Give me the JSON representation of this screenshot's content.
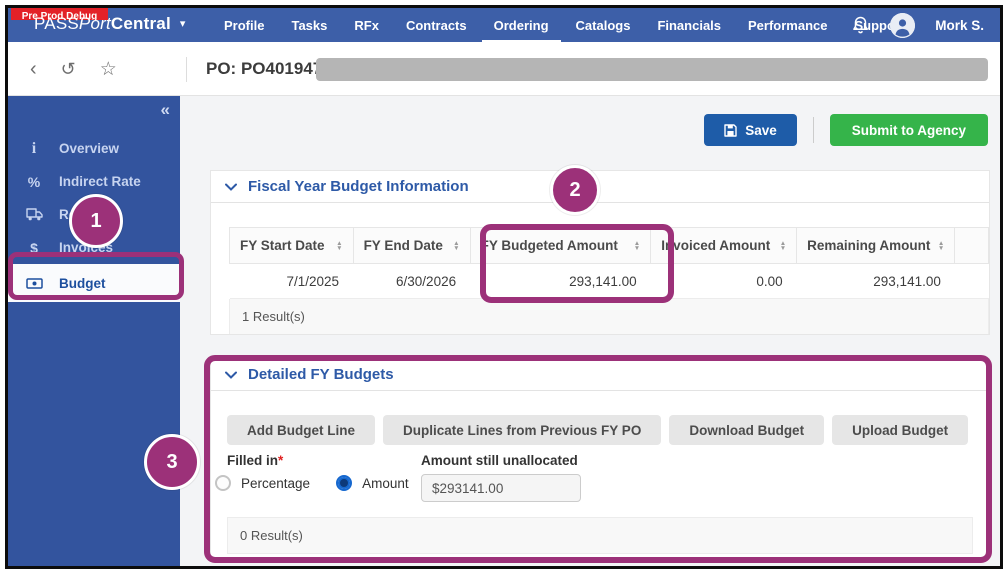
{
  "env_badge": "Pre Prod Debug",
  "brand": {
    "part1": "PASS",
    "part2": "Port",
    "part3": "Central"
  },
  "nav": {
    "items": [
      "Profile",
      "Tasks",
      "RFx",
      "Contracts",
      "Ordering",
      "Catalogs",
      "Financials",
      "Performance",
      "Support"
    ],
    "active_item": "Ordering",
    "user_name": "Mork S."
  },
  "po_header": {
    "title": "PO: PO401947"
  },
  "sidebar": {
    "items": [
      {
        "label": "Overview",
        "icon": "info-icon"
      },
      {
        "label": "Indirect Rate",
        "icon": "percent-icon"
      },
      {
        "label": "Receipts",
        "icon": "truck-icon"
      },
      {
        "label": "Invoices",
        "icon": "dollar-icon"
      },
      {
        "label": "Budget",
        "icon": "banknote-icon",
        "active": true
      }
    ]
  },
  "actions": {
    "save_label": "Save",
    "submit_label": "Submit to Agency"
  },
  "fy_section": {
    "title": "Fiscal Year Budget Information",
    "columns": [
      "FY Start Date",
      "FY End Date",
      "FY Budgeted Amount",
      "Invoiced Amount",
      "Remaining Amount"
    ],
    "rows": [
      [
        "7/1/2025",
        "6/30/2026",
        "293,141.00",
        "0.00",
        "293,141.00"
      ]
    ],
    "results_text": "1 Result(s)"
  },
  "detailed_section": {
    "title": "Detailed FY Budgets",
    "buttons": [
      "Add Budget Line",
      "Duplicate Lines from Previous FY PO",
      "Download Budget",
      "Upload Budget"
    ],
    "filled_in_label": "Filled in",
    "required_marker": "*",
    "radio_options": {
      "percentage": "Percentage",
      "amount": "Amount"
    },
    "selected_option": "Amount",
    "unallocated_label": "Amount still unallocated",
    "unallocated_value": "$293141.00",
    "results_text": "0 Result(s)"
  },
  "annotations": {
    "step1": "1",
    "step2": "2",
    "step3": "3"
  },
  "colors": {
    "nav_blue": "#3d5fa8",
    "sidebar_blue": "#33549e",
    "badge_red": "#e32128",
    "save_blue": "#1e5ca8",
    "submit_green": "#35b44a",
    "section_title_blue": "#2e5aa7",
    "annotation_purple": "#9c3179",
    "redaction_gray": "#b5b5b5"
  }
}
